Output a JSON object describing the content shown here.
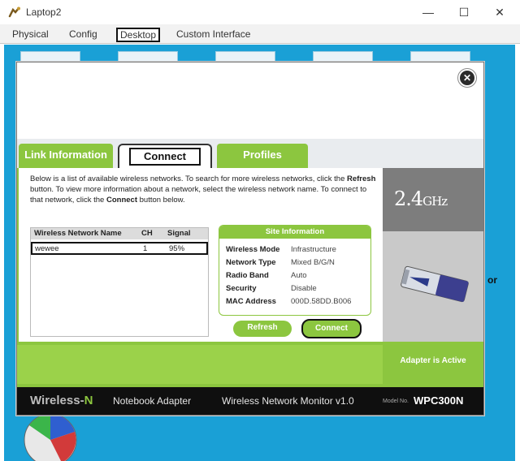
{
  "window": {
    "title": "Laptop2",
    "minimize": "—",
    "maximize": "☐",
    "close": "✕"
  },
  "tabs": [
    {
      "label": "Physical"
    },
    {
      "label": "Config"
    },
    {
      "label": "Desktop"
    },
    {
      "label": "Custom Interface"
    }
  ],
  "dialog": {
    "close_glyph": "✕",
    "tabs": {
      "link_information": "Link Information",
      "connect": "Connect",
      "profiles": "Profiles"
    },
    "description": {
      "part1": "Below is a list of available wireless networks. To search for more wireless networks, click the ",
      "refresh_word": "Refresh",
      "part2": " button. To view more information about a network, select the wireless network name. To connect to that network, click the ",
      "connect_word": "Connect",
      "part3": " button below."
    },
    "network_list": {
      "headers": {
        "name": "Wireless Network Name",
        "ch": "CH",
        "signal": "Signal"
      },
      "rows": [
        {
          "name": "wewee",
          "ch": "1",
          "signal": "95%"
        }
      ]
    },
    "site_information": {
      "title": "Site Information",
      "rows": [
        {
          "label": "Wireless Mode",
          "value": "Infrastructure"
        },
        {
          "label": "Network Type",
          "value": "Mixed B/G/N"
        },
        {
          "label": "Radio Band",
          "value": "Auto"
        },
        {
          "label": "Security",
          "value": "Disable"
        },
        {
          "label": "MAC Address",
          "value": "000D.58DD.B006"
        }
      ]
    },
    "refresh_button": "Refresh",
    "connect_button": "Connect",
    "right_panel": {
      "frequency": "2.4",
      "frequency_unit": "GHz",
      "adapter_status": "Adapter is Active"
    },
    "footer": {
      "brand_prefix": "Wireless-",
      "brand_suffix": "N",
      "subtitle": "Notebook Adapter",
      "monitor": "Wireless Network Monitor  v1.0",
      "model_label": "Model No.",
      "model": "WPC300N"
    }
  },
  "background": {
    "side_text": "or"
  },
  "colors": {
    "accent_green": "#8cc63f",
    "desktop_blue": "#1aa0d6",
    "footer_black": "#0f0f0f"
  },
  "icons": [
    "app-icon",
    "close-icon",
    "pc-card-icon"
  ]
}
